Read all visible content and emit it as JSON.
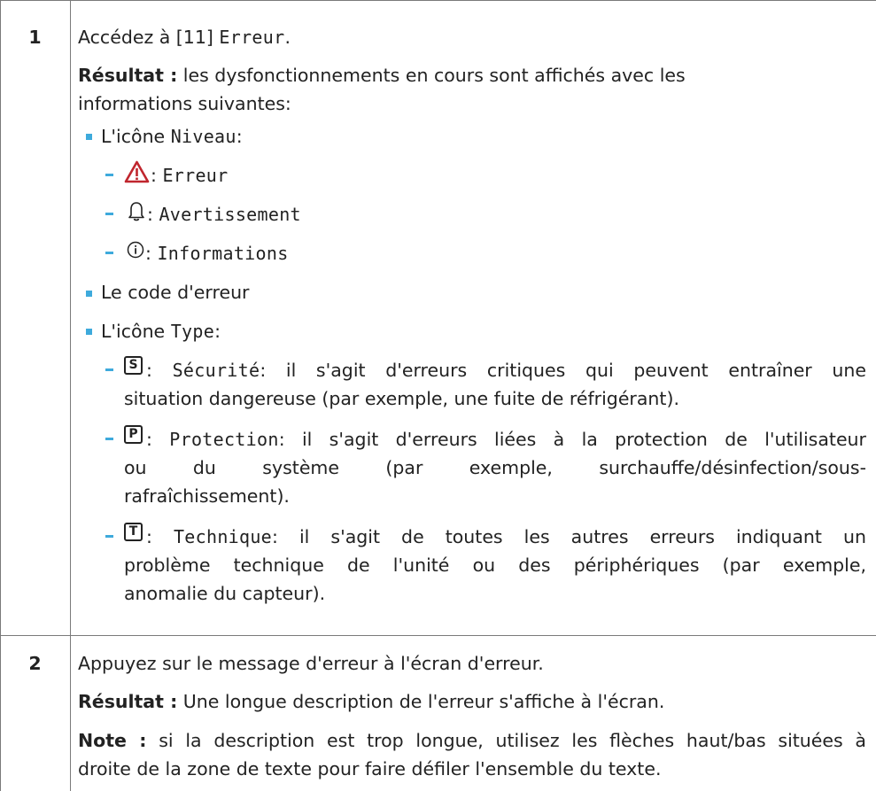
{
  "steps": [
    {
      "number": "1",
      "intro": {
        "pre": "Accédez à [11] ",
        "menu": "Erreur",
        "post": "."
      },
      "result": {
        "label": "Résultat :",
        "text_line1": " les dysfonctionnements en cours sont affichés avec les",
        "text_line2": "informations suivantes:"
      },
      "level": {
        "pre": "L'icône ",
        "name": "Niveau",
        "post": ":",
        "items": [
          {
            "icon": "warning-triangle-icon",
            "sep": ": ",
            "label": "Erreur"
          },
          {
            "icon": "bell-icon",
            "sep": ": ",
            "label": "Avertissement"
          },
          {
            "icon": "info-circle-icon",
            "sep": ": ",
            "label": "Informations"
          }
        ]
      },
      "error_code": "Le code d'erreur",
      "type": {
        "pre": "L'icône ",
        "name": "Type",
        "post": ":",
        "items": [
          {
            "icon": "S",
            "sep": ": ",
            "label": "Sécurité",
            "line1": ": il s'agit d'erreurs critiques qui peuvent entraîner une",
            "line2": "situation dangereuse (par exemple, une fuite de réfrigérant)."
          },
          {
            "icon": "P",
            "sep": ": ",
            "label": "Protection",
            "line1": ": il s'agit d'erreurs liées à la protection de l'utilisateur",
            "line2": "ou du système (par exemple, surchauffe/désinfection/sous-",
            "line3": "rafraîchissement)."
          },
          {
            "icon": "T",
            "sep": ": ",
            "label": "Technique",
            "line1": ": il s'agit de toutes les autres erreurs indiquant un",
            "line2": "problème technique de l'unité ou des périphériques (par exemple,",
            "line3": "anomalie du capteur)."
          }
        ]
      }
    },
    {
      "number": "2",
      "intro": "Appuyez sur le message d'erreur à l'écran d'erreur.",
      "result": {
        "label": "Résultat :",
        "text": " Une longue description de l'erreur s'affiche à l'écran."
      },
      "note": {
        "label": "Note :",
        "line1": " si la description est trop longue, utilisez les flèches haut/bas situées à",
        "line2": "droite de la zone de texte pour faire défiler l'ensemble du texte."
      }
    }
  ],
  "colors": {
    "bullet": "#3eaadc",
    "warning": "#c0262e",
    "border": "#7a7a7a"
  }
}
